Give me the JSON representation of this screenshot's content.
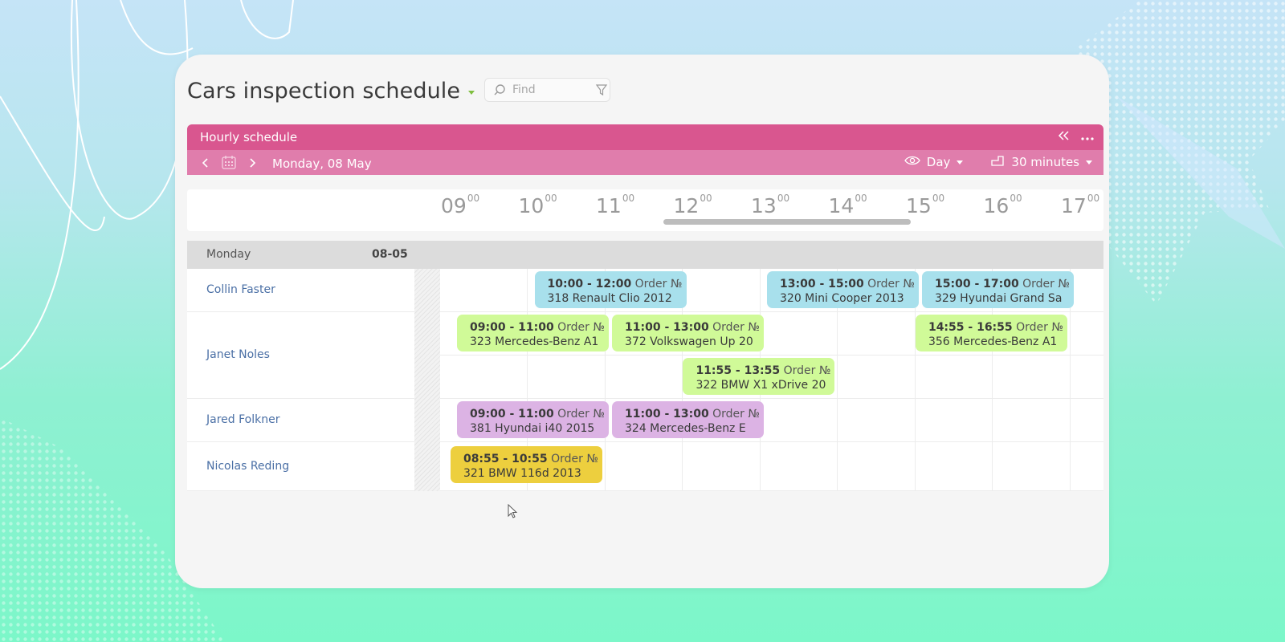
{
  "app": {
    "title": "Cars inspection schedule"
  },
  "search": {
    "placeholder": "Find"
  },
  "panel": {
    "header_label": "Hourly schedule",
    "date_label": "Monday, 08 May",
    "view_mode": "Day",
    "interval": "30 minutes"
  },
  "timeline": {
    "hours": [
      {
        "h": "09",
        "m": "00"
      },
      {
        "h": "10",
        "m": "00"
      },
      {
        "h": "11",
        "m": "00"
      },
      {
        "h": "12",
        "m": "00"
      },
      {
        "h": "13",
        "m": "00"
      },
      {
        "h": "14",
        "m": "00"
      },
      {
        "h": "15",
        "m": "00"
      },
      {
        "h": "16",
        "m": "00"
      },
      {
        "h": "17",
        "m": "00"
      }
    ]
  },
  "day": {
    "name": "Monday",
    "date": "08-05"
  },
  "resources": [
    {
      "name": "Collin Faster"
    },
    {
      "name": "Janet Noles"
    },
    {
      "name": "Jared Folkner"
    },
    {
      "name": "Nicolas Reding"
    }
  ],
  "events": [
    {
      "resource": 0,
      "time": "10:00 - 12:00",
      "order_label": "Order №",
      "detail": "318 Renault Clio 2012",
      "color": "blue"
    },
    {
      "resource": 0,
      "time": "13:00 - 15:00",
      "order_label": "Order №",
      "detail": "320 Mini Cooper 2013",
      "color": "blue"
    },
    {
      "resource": 0,
      "time": "15:00 - 17:00",
      "order_label": "Order №",
      "detail": "329 Hyundai Grand Sa",
      "color": "blue"
    },
    {
      "resource": 1,
      "time": "09:00 - 11:00",
      "order_label": "Order №",
      "detail": "323 Mercedes-Benz A1",
      "color": "green"
    },
    {
      "resource": 1,
      "time": "11:00 - 13:00",
      "order_label": "Order №",
      "detail": "372 Volkswagen Up 20",
      "color": "green"
    },
    {
      "resource": 1,
      "time": "14:55 - 16:55",
      "order_label": "Order №",
      "detail": "356 Mercedes-Benz A1",
      "color": "green"
    },
    {
      "resource": 1,
      "time": "11:55 - 13:55",
      "order_label": "Order №",
      "detail": "322 BMW X1 xDrive 20",
      "color": "green"
    },
    {
      "resource": 2,
      "time": "09:00 - 11:00",
      "order_label": "Order №",
      "detail": "381 Hyundai i40 2015",
      "color": "purple"
    },
    {
      "resource": 2,
      "time": "11:00 - 13:00",
      "order_label": "Order №",
      "detail": "324 Mercedes-Benz E",
      "color": "purple"
    },
    {
      "resource": 3,
      "time": "08:55 - 10:55",
      "order_label": "Order №",
      "detail": "321 BMW 116d 2013",
      "color": "yellow"
    }
  ],
  "colors": {
    "header": "#d9568f",
    "subheader": "#e07dac",
    "blue_event": "#a8e0ec",
    "green_event": "#d0fa98",
    "purple_event": "#dcb3e4",
    "yellow_event": "#edcf3e"
  }
}
